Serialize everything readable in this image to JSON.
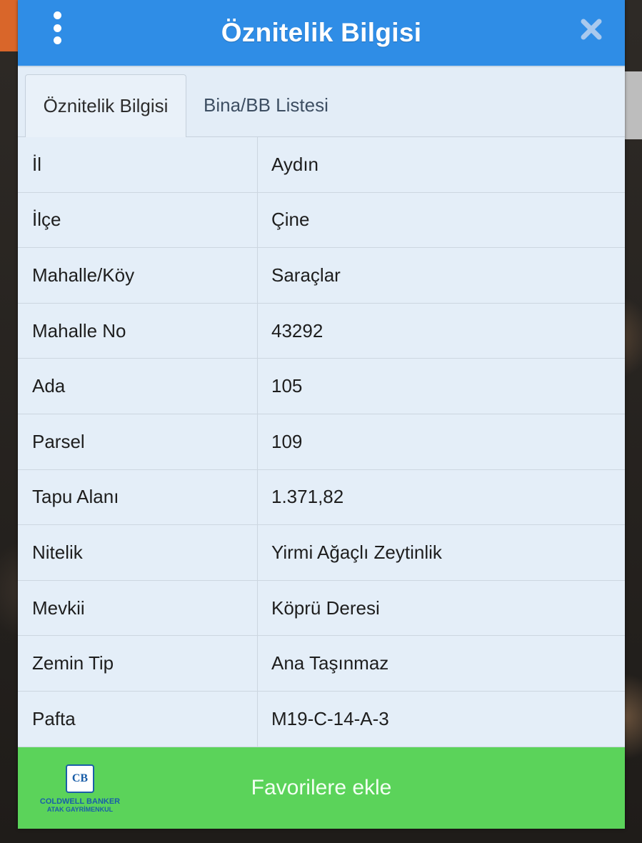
{
  "dialog": {
    "title": "Öznitelik Bilgisi",
    "menu_icon": "more-vertical-icon",
    "close_icon": "close-icon"
  },
  "tabs": [
    {
      "label": "Öznitelik Bilgisi",
      "active": true
    },
    {
      "label": "Bina/BB Listesi",
      "active": false
    }
  ],
  "attributes": [
    {
      "key": "İl",
      "value": "Aydın"
    },
    {
      "key": "İlçe",
      "value": "Çine"
    },
    {
      "key": "Mahalle/Köy",
      "value": "Saraçlar"
    },
    {
      "key": "Mahalle No",
      "value": "43292"
    },
    {
      "key": "Ada",
      "value": "105"
    },
    {
      "key": "Parsel",
      "value": "109"
    },
    {
      "key": "Tapu Alanı",
      "value": "1.371,82"
    },
    {
      "key": "Nitelik",
      "value": "Yirmi Ağaçlı Zeytinlik"
    },
    {
      "key": "Mevkii",
      "value": "Köprü Deresi"
    },
    {
      "key": "Zemin Tip",
      "value": "Ana Taşınmaz"
    },
    {
      "key": "Pafta",
      "value": "M19-C-14-A-3"
    }
  ],
  "footer": {
    "favorite_label": "Favorilere ekle"
  },
  "logo": {
    "mark": "CB",
    "name": "COLDWELL BANKER",
    "sub": "ATAK GAYRİMENKUL"
  },
  "colors": {
    "titlebar": "#2f8de6",
    "favorite_button": "#5bd35a",
    "table_bg": "#e4eef8"
  }
}
